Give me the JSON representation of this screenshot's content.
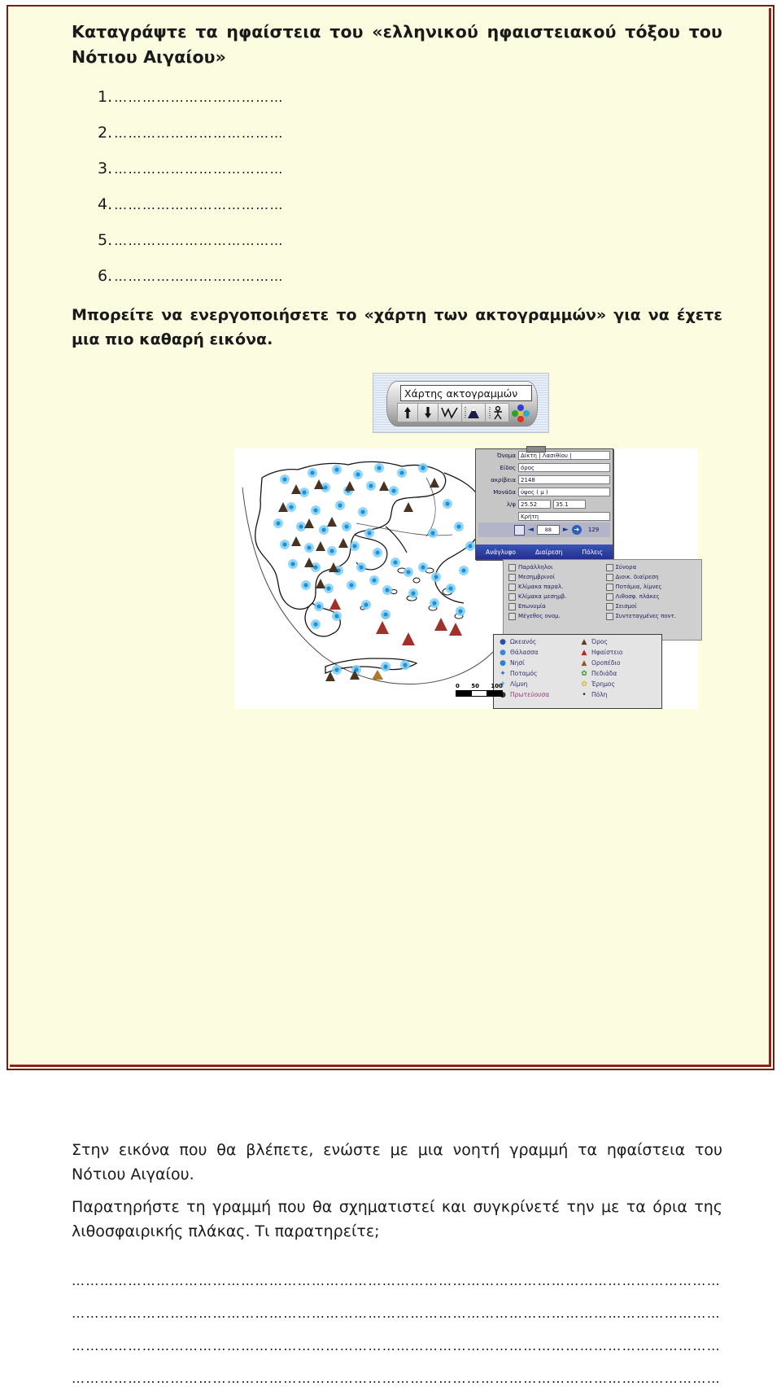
{
  "page": {
    "heading": "Καταγράψτε τα ηφαίστεια του «ελληνικού ηφαιστειακού τόξου του Νότιου Αιγαίου»",
    "answer_numbers": [
      "1.",
      "2.",
      "3.",
      "4.",
      "5.",
      "6."
    ],
    "blank_dots_short": "………………………………",
    "blank_dots_full": "………………………………………………………………………………………………………………………………………………………………………………………………",
    "paragraph_activate": "Μπορείτε να ενεργοποιήσετε το «χάρτη των ακτογραμμών» για να έχετε μια πιο καθαρή εικόνα.",
    "paragraph_connect": "Στην εικόνα που θα βλέπετε, ενώστε με μια νοητή γραμμή τα ηφαίστεια του Νότιου Αιγαίου.",
    "paragraph_observe": "Παρατηρήστε τη γραμμή που θα σχηματιστεί και συγκρίνετέ την με τα όρια της λιθοσφαιρικής πλάκας. Τι παρατηρείτε;",
    "answer_line_count": 4
  },
  "screenshot": {
    "toolbar": {
      "tooltip": "Χάρτης ακτογραμμών",
      "buttons": [
        {
          "name": "arrow-up-icon",
          "label": "Πάνω"
        },
        {
          "name": "arrow-down-icon",
          "label": "Κάτω"
        },
        {
          "name": "coastline-icon",
          "label": "Ακτογραμμές"
        },
        {
          "name": "mountain-icon",
          "label": "Ανάγλυφο"
        },
        {
          "name": "person-icon",
          "label": "Πληθυσμός"
        },
        {
          "name": "color-palette-icon",
          "label": "Χρώματα"
        }
      ]
    },
    "properties_dialog": {
      "fields": [
        {
          "label": "Όνομα",
          "value": "Δίκτη | Λασιθίου |"
        },
        {
          "label": "Είδος",
          "value": "όρος"
        },
        {
          "label": "ακρίβεια",
          "value": "2148"
        },
        {
          "label": "Μονάδα",
          "value": "ύψος ( μ )"
        },
        {
          "label": "λ/φ",
          "value": "25.52",
          "value2": "35.1"
        },
        {
          "label": "",
          "value": "Κρήτη"
        }
      ],
      "nav": {
        "current": "88",
        "total": "129"
      },
      "buttons": [
        "Ανάγλυφο",
        "Διαίρεση",
        "Πόλεις"
      ]
    },
    "layers_panel": {
      "items": [
        "Παράλληλοι",
        "Σύνορα",
        "Μεσημβρινοί",
        "Διοικ. διαίρεση",
        "Κλίμακα παραλ.",
        "Ποτάμια, λίμνες",
        "Κλίμακα μεσημβ.",
        "Λιθοσφ. πλάκες",
        "Επωνυμία",
        "Σεισμοί",
        "Μέγεθος ονομ.",
        "Συντεταγμένες ποντ."
      ]
    },
    "map_legend": {
      "items": [
        {
          "label": "Ωκεανός",
          "glyph": "●",
          "color": "#2a4fa8"
        },
        {
          "label": "Όρος",
          "glyph": "▲",
          "color": "#5a3a20"
        },
        {
          "label": "Θάλασσα",
          "glyph": "●",
          "color": "#3a86d8"
        },
        {
          "label": "Ηφαίστειο",
          "glyph": "▲",
          "color": "#c02020"
        },
        {
          "label": "Νησί",
          "glyph": "●",
          "color": "#2f7fd0"
        },
        {
          "label": "Οροπέδιο",
          "glyph": "▲",
          "color": "#8a5a28"
        },
        {
          "label": "Ποταμός",
          "glyph": "✦",
          "color": "#2f6fc0"
        },
        {
          "label": "Πεδιάδα",
          "glyph": "✿",
          "color": "#2f9a2f"
        },
        {
          "label": "Λίμνη",
          "glyph": "✦",
          "color": "#4fa8e8"
        },
        {
          "label": "Έρημος",
          "glyph": "✿",
          "color": "#d8b828"
        },
        {
          "label": "Πρωτεύουσα",
          "glyph": "●",
          "color": "#303030"
        },
        {
          "label": "Πόλη",
          "glyph": "•",
          "color": "#202020"
        }
      ]
    },
    "scale_bar": {
      "ticks": [
        "0",
        "50",
        "100"
      ]
    }
  },
  "colors": {
    "page_background": "#fcfce0",
    "border": "#8a2222",
    "text": "#1a1a1a",
    "map_marker_blue": "#2f9fe0",
    "map_volcano_red": "#a33028"
  }
}
